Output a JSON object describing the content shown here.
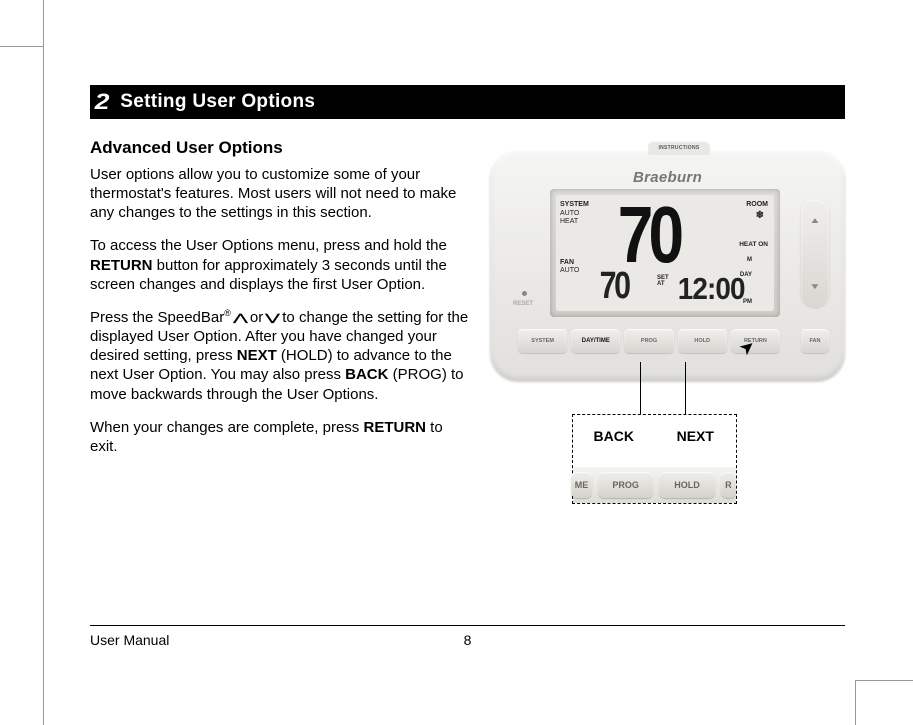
{
  "section": {
    "number": "2",
    "title": "Setting User Options"
  },
  "heading": "Advanced User Options",
  "para1": "User options allow you to customize some of your thermostat's features. Most users will not need to make any changes to the settings in this section.",
  "para2a": "To access the User Options menu, press and hold the ",
  "para2b": "RETURN",
  "para2c": " button for approximately 3 seconds until the screen changes and displays the first User Option.",
  "para3a": "Press the SpeedBar",
  "para3reg": "®",
  "para3b": " or ",
  "para3c": " to change the setting for the displayed User Option. After you have changed your desired setting, press ",
  "para3next": "NEXT",
  "para3d": " (HOLD) to advance to the next User Option. You may also press ",
  "para3back": "BACK",
  "para3e": " (PROG) to move backwards through the User Options.",
  "para4a": "When your changes are complete, press ",
  "para4b": "RETURN",
  "para4c": " to exit.",
  "device": {
    "instructions": "INSTRUCTIONS",
    "brand": "Braeburn",
    "screen": {
      "system": "SYSTEM",
      "auto1": "AUTO",
      "heat": "HEAT",
      "fan": "FAN",
      "auto2": "AUTO",
      "room": "ROOM",
      "snow": "❄",
      "heaton": "HEAT ON",
      "m": "M",
      "day": "DAY",
      "pm": "PM",
      "setat": "SET\nAT",
      "bigtemp": "70",
      "smalltemp": "70",
      "time": "12:00"
    },
    "reset": "RESET",
    "buttons": {
      "system": "SYSTEM",
      "daytime": "DAY/TIME",
      "prog": "PROG",
      "hold": "HOLD",
      "return": "RETURN",
      "fan": "FAN"
    }
  },
  "zoom": {
    "back": "BACK",
    "next": "NEXT",
    "me": "ME",
    "prog": "PROG",
    "hold": "HOLD",
    "r": "R"
  },
  "footer": {
    "left": "User Manual",
    "center": "8"
  }
}
